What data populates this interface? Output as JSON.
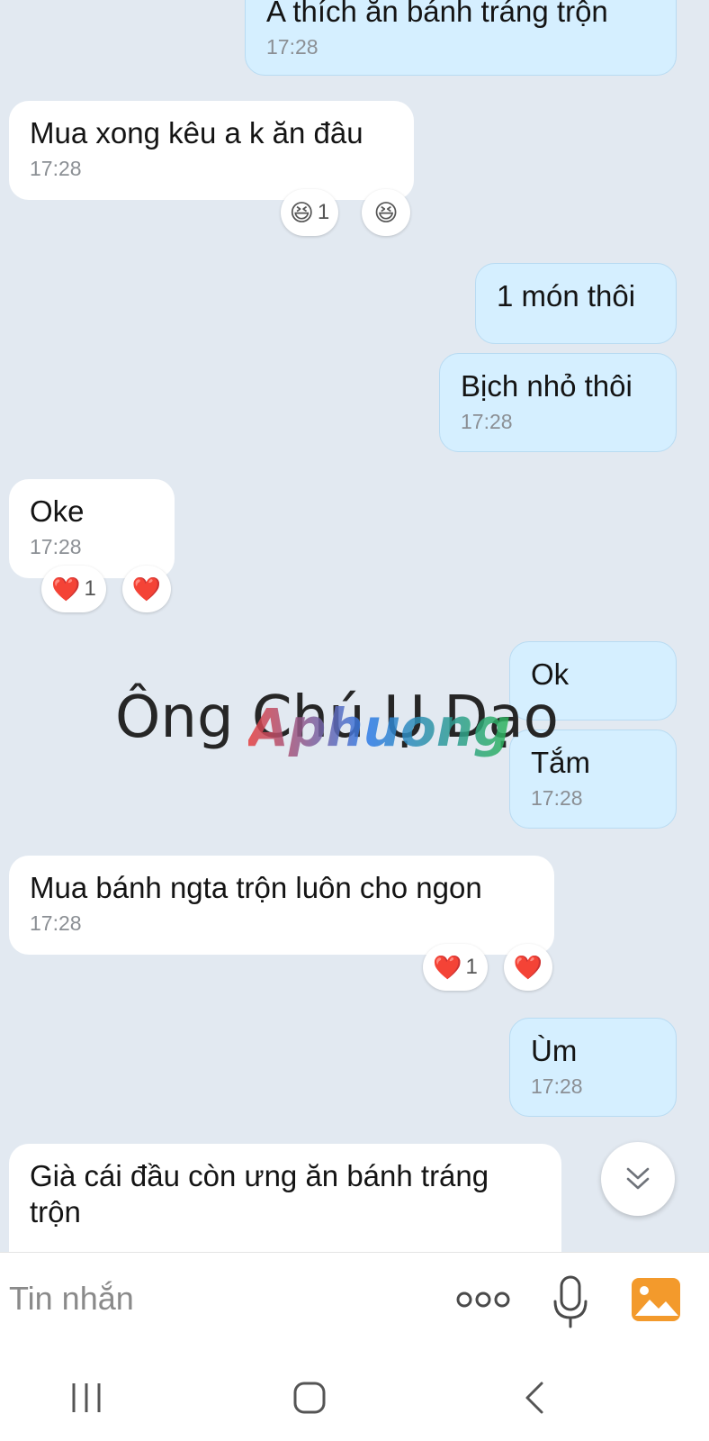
{
  "messages": [
    {
      "dir": "out",
      "text": "A thích ăn bánh tráng trộn",
      "time": "17:28"
    },
    {
      "dir": "in",
      "text": "Mua xong kêu a k ăn đâu",
      "time": "17:28",
      "reaction": {
        "emoji": "😆",
        "count": "1"
      },
      "add_emoji": "😆"
    },
    {
      "dir": "out",
      "text": "1 món thôi"
    },
    {
      "dir": "out",
      "text": "Bịch nhỏ thôi",
      "time": "17:28"
    },
    {
      "dir": "in",
      "text": "Oke",
      "time": "17:28",
      "reaction": {
        "emoji": "❤️",
        "count": "1"
      },
      "add_emoji": "❤️"
    },
    {
      "dir": "out",
      "text": "Ok"
    },
    {
      "dir": "out",
      "text": "Tắm",
      "time": "17:28"
    },
    {
      "dir": "in",
      "text": "Mua bánh ngta trộn luôn cho ngon",
      "time": "17:28",
      "reaction": {
        "emoji": "❤️",
        "count": "1"
      },
      "add_emoji": "❤️"
    },
    {
      "dir": "out",
      "text": "Ùm",
      "time": "17:28"
    },
    {
      "dir": "in",
      "text": "Già cái đầu còn ưng ăn bánh tráng\ntrộn"
    }
  ],
  "watermark": {
    "text": "Ông Chú Ụ Dạo",
    "logo": "Aphuong"
  },
  "composer": {
    "placeholder": "Tin nhắn"
  },
  "icons": {
    "scroll": "chevron-double-down-icon",
    "more": "more-dots-icon",
    "mic": "microphone-icon",
    "image": "image-icon",
    "recent": "recent-apps-icon",
    "home": "home-icon",
    "back": "back-icon"
  },
  "colors": {
    "bg": "#e2e9f1",
    "out_bubble": "#d5efff",
    "in_bubble": "#ffffff",
    "accent": "#f39a2c"
  }
}
